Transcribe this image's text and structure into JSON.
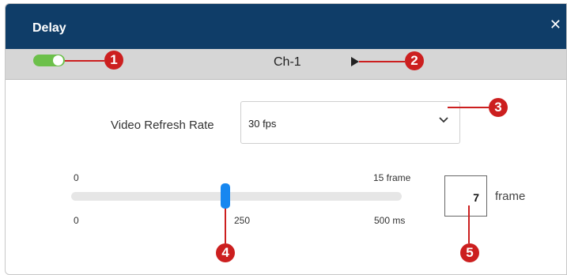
{
  "dialog": {
    "title": "Delay",
    "close_glyph": "✕"
  },
  "channel_bar": {
    "toggle_state": "on",
    "channel_name": "Ch-1"
  },
  "video_refresh": {
    "label": "Video Refresh Rate",
    "value": "30 fps"
  },
  "slider": {
    "frame_min_label": "0",
    "frame_max_label": "15 frame",
    "ms_min_label": "0",
    "ms_mid_label": "250",
    "ms_max_label": "500 ms",
    "value_fraction": 0.4667
  },
  "frame_input": {
    "value": "7",
    "unit": "frame"
  },
  "annotations": {
    "a1": "1",
    "a2": "2",
    "a3": "3",
    "a4": "4",
    "a5": "5"
  },
  "colors": {
    "title_bar": "#0f3d68",
    "toggle_on": "#6cc04a",
    "slider_thumb": "#1787f0",
    "callout": "#cc1f1f"
  }
}
